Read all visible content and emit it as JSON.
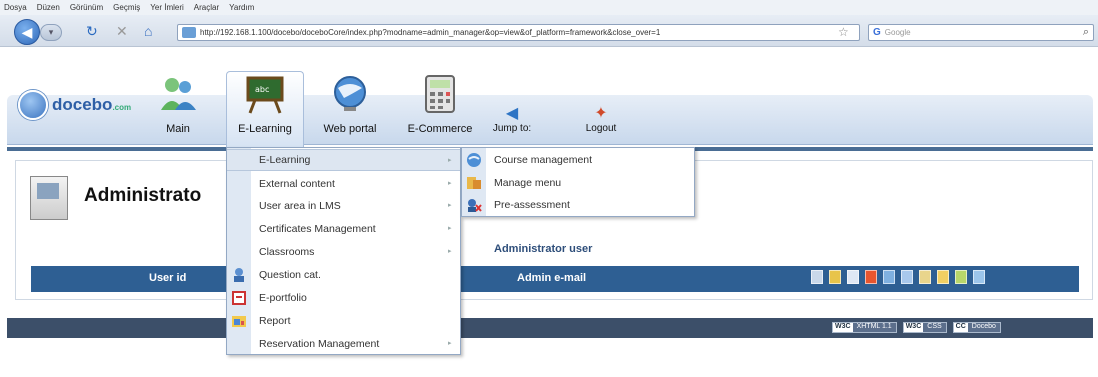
{
  "browser": {
    "menu": [
      "Dosya",
      "Düzen",
      "Görünüm",
      "Geçmiş",
      "Yer İmleri",
      "Araçlar",
      "Yardım"
    ],
    "url": "http://192.168.1.100/docebo/doceboCore/index.php?modname=admin_manager&op=view&of_platform=framework&close_over=1",
    "search_engine": "Google",
    "search_placeholder": "Google"
  },
  "app": {
    "logo_text": "docebo",
    "logo_suffix": ".com",
    "tabs": [
      {
        "label": "Main",
        "icon": "users-icon"
      },
      {
        "label": "E-Learning",
        "icon": "blackboard-icon",
        "selected": true
      },
      {
        "label": "Web portal",
        "icon": "globe-icon"
      },
      {
        "label": "E-Commerce",
        "icon": "calculator-icon"
      }
    ],
    "small_nav": [
      {
        "label": "Jump to:",
        "icon": "jump-icon"
      },
      {
        "label": "Logout",
        "icon": "logout-icon"
      }
    ]
  },
  "page": {
    "title": "Administrato",
    "subtitle": "Administrator user",
    "table_headers": {
      "user_id": "User id",
      "admin_email": "Admin e-mail"
    }
  },
  "dropdown": {
    "items": [
      {
        "label": "E-Learning",
        "has_submenu": true,
        "active": true
      },
      {
        "label": "External content",
        "has_submenu": true
      },
      {
        "label": "User area in LMS",
        "has_submenu": true
      },
      {
        "label": "Certificates Management",
        "has_submenu": true
      },
      {
        "label": "Classrooms",
        "has_submenu": true
      },
      {
        "label": "Question cat.",
        "icon": "question-icon"
      },
      {
        "label": "E-portfolio",
        "icon": "portfolio-icon"
      },
      {
        "label": "Report",
        "icon": "report-icon"
      },
      {
        "label": "Reservation Management",
        "has_submenu": true
      }
    ]
  },
  "submenu": {
    "items": [
      {
        "label": "Course management",
        "icon": "course-icon"
      },
      {
        "label": "Manage menu",
        "icon": "menu-icon"
      },
      {
        "label": "Pre-assessment",
        "icon": "assessment-icon"
      }
    ]
  },
  "footer": {
    "badges": [
      {
        "prefix": "W3C",
        "label": "XHTML 1.1"
      },
      {
        "prefix": "W3C",
        "label": "CSS"
      },
      {
        "prefix": "CC",
        "label": "Docebo"
      }
    ]
  },
  "colors": {
    "header_blue": "#2e5f93",
    "footer": "#3c4f69",
    "accent": "#2e5fa6"
  }
}
